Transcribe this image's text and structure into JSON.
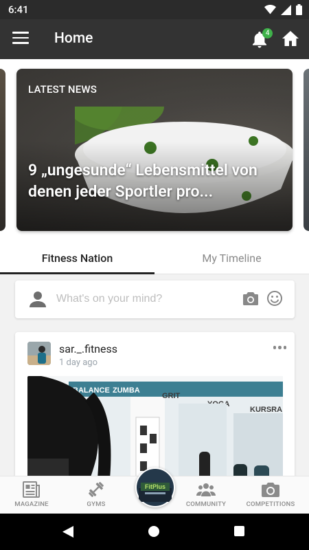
{
  "status_bar": {
    "time": "6:41"
  },
  "app_bar": {
    "title": "Home",
    "notification_count": "4"
  },
  "news_card": {
    "label": "LATEST NEWS",
    "headline": "9 „ungesunde“ Lebensmittel von denen jeder Sportler pro..."
  },
  "tabs": [
    {
      "label": "Fitness Nation",
      "active": true
    },
    {
      "label": "My Timeline",
      "active": false
    }
  ],
  "composer": {
    "placeholder": "What's on your mind?"
  },
  "post": {
    "username": "sar._.fitness",
    "time": "1 day ago",
    "photo_signs": [
      "BALANCE",
      "ZUMBA",
      "GRIT",
      "YOGA",
      "KURSRA"
    ]
  },
  "bottom_nav": {
    "magazine": "MAGAZINE",
    "gyms": "GYMS",
    "community": "COMMUNITY",
    "competitions": "COMPETITIONS",
    "center_logo": "FitPlus"
  },
  "colors": {
    "app_bar": "#333333",
    "badge": "#3fb24a",
    "nav_icon": "#8a8a8a"
  }
}
